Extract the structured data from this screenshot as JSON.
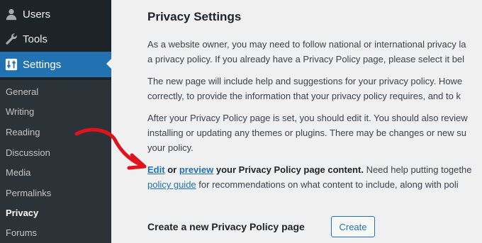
{
  "sidebar": {
    "menu": [
      {
        "label": "Users",
        "icon": "users-icon"
      },
      {
        "label": "Tools",
        "icon": "tools-icon"
      },
      {
        "label": "Settings",
        "icon": "settings-icon"
      }
    ],
    "submenu": [
      "General",
      "Writing",
      "Reading",
      "Discussion",
      "Media",
      "Permalinks",
      "Privacy",
      "Forums"
    ],
    "current_submenu": "Privacy"
  },
  "main": {
    "title": "Privacy Settings",
    "para1": {
      "line1": "As a website owner, you may need to follow national or international privacy la",
      "line2": "a privacy policy. If you already have a Privacy Policy page, please select it bel"
    },
    "para2": {
      "line1": "The new page will include help and suggestions for your privacy policy. Howe",
      "line2": "correctly, to provide the information that your privacy policy requires, and to k"
    },
    "para3": {
      "line1": "After your Privacy Policy page is set, you should edit it. You should also review",
      "line2": "installing or updating any themes or plugins. There may be changes or new su",
      "line3": "your policy."
    },
    "para4": {
      "edit_link": "Edit",
      "or": "or",
      "preview_link": "preview",
      "strong_tail": "your Privacy Policy page content.",
      "tail": "Need help putting togethe",
      "guide_link": "policy guide",
      "line2_tail": "for recommendations on what content to include, along with poli"
    },
    "create_label": "Create a new Privacy Policy page",
    "create_button": "Create"
  },
  "colors": {
    "sidebar_bg": "#1d2327",
    "submenu_bg": "#2c3338",
    "accent": "#2271b1",
    "annotation_arrow": "#e0131b"
  }
}
